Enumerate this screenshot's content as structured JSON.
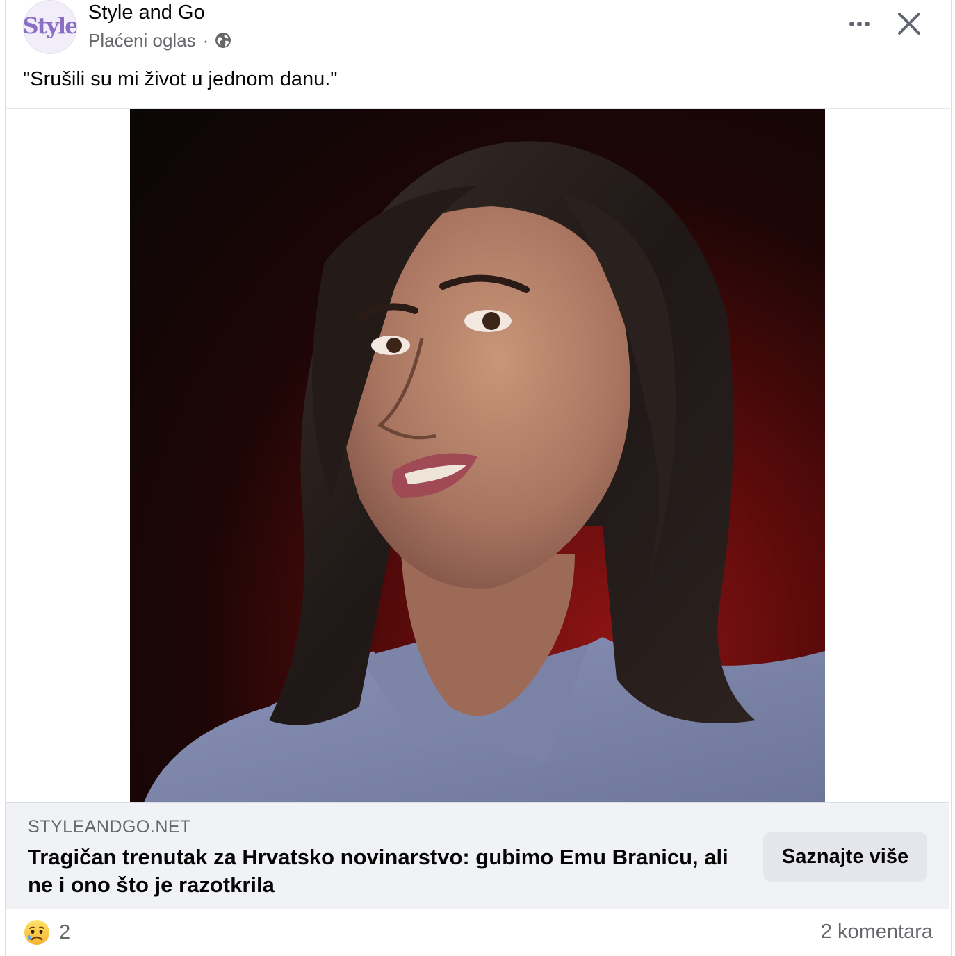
{
  "post": {
    "avatar_text": "Style",
    "page_name": "Style and Go",
    "sponsored_label": "Plaćeni oglas",
    "separator": "·",
    "caption": "\"Srušili su mi život u jednom danu.\""
  },
  "link_preview": {
    "domain": "STYLEANDGO.NET",
    "headline": "Tragičan trenutak za Hrvatsko novinarstvo: gubimo Emu Branicu, ali ne i ono što je razotkrila",
    "cta_label": "Saznajte više"
  },
  "footer": {
    "reaction_count": "2",
    "comments_label": "2 komentara"
  },
  "colors": {
    "accent_avatar": "#8b6fc4",
    "secondary_text": "#65676b",
    "link_bar_bg": "#f0f2f5"
  },
  "icons": [
    "globe-icon",
    "more-icon",
    "close-icon",
    "sad-reaction-icon"
  ]
}
